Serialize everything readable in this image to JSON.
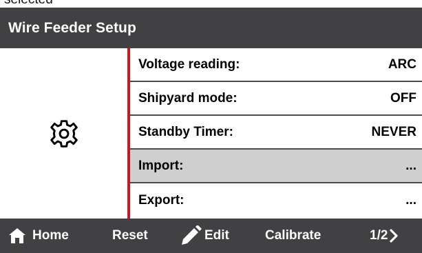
{
  "caption": "selected",
  "window": {
    "title": "Wire Feeder Setup"
  },
  "icons": {
    "settings": "gear-icon",
    "home": "house-icon",
    "edit": "pencil-icon",
    "next": "chevron-right-icon"
  },
  "colors": {
    "bar": "#414042",
    "accent": "#d0161d",
    "selected_row": "#cfcfcf"
  },
  "menu": {
    "items": [
      {
        "label": "Voltage reading:",
        "value": "ARC"
      },
      {
        "label": "Shipyard mode:",
        "value": "OFF"
      },
      {
        "label": "Standby Timer:",
        "value": "NEVER"
      },
      {
        "label": "Import:",
        "value": "...",
        "selected": true
      },
      {
        "label": "Export:",
        "value": "..."
      }
    ]
  },
  "toolbar": {
    "home_label": "Home",
    "reset_label": "Reset",
    "edit_label": "Edit",
    "calibrate_label": "Calibrate",
    "page_label": "1/2"
  }
}
